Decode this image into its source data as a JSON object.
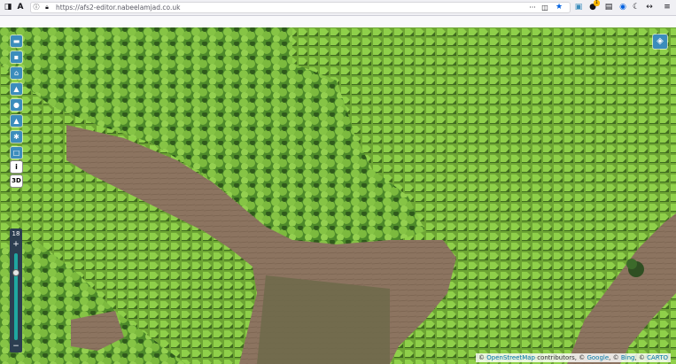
{
  "browser": {
    "url": "https://afs2-editor.nabeelamjad.co.uk",
    "toolbar_icons": [
      "back-icon",
      "firefox-account-icon",
      "text-icon",
      "shield-icon",
      "more-icon",
      "pocket-icon",
      "bookmark-star-icon",
      "extension-icon",
      "counter-extension-icon",
      "library-icon",
      "sync-icon",
      "moon-icon",
      "overflow-icon",
      "menu-icon"
    ],
    "counter_badge": "1"
  },
  "map": {
    "zoom_level": "18",
    "zoom_plus": "+",
    "zoom_minus": "−",
    "zoom_slider_position": 0.2,
    "tools": [
      {
        "name": "open-folder-button",
        "icon": "folder-icon",
        "glyph": "▬"
      },
      {
        "name": "save-button",
        "icon": "save-icon",
        "glyph": "▪"
      },
      {
        "name": "home-button",
        "icon": "home-icon",
        "glyph": "⌂"
      },
      {
        "name": "tree-button",
        "icon": "tree-icon",
        "glyph": "▲"
      },
      {
        "name": "marker-button",
        "icon": "marker-icon",
        "glyph": "●"
      },
      {
        "name": "tree-alt-button",
        "icon": "tree-icon",
        "glyph": "▲"
      },
      {
        "name": "settings-button",
        "icon": "gear-icon",
        "glyph": "✱"
      },
      {
        "name": "rectangle-button",
        "icon": "square-icon",
        "glyph": "□"
      }
    ],
    "info_label": "i",
    "three_d_label": "3D",
    "layers_icon": "layers-icon",
    "attribution": {
      "prefix": "© ",
      "osm": "OpenStreetMap",
      "contrib": " contributors, © ",
      "google": "Google",
      "sep1": ", © ",
      "bing": "Bing",
      "sep2": ", © ",
      "carto": "CARTO"
    }
  },
  "colors": {
    "accent": "#3c8dbc",
    "orchard_green": "#7fc241",
    "dirt": "#8c7460"
  }
}
